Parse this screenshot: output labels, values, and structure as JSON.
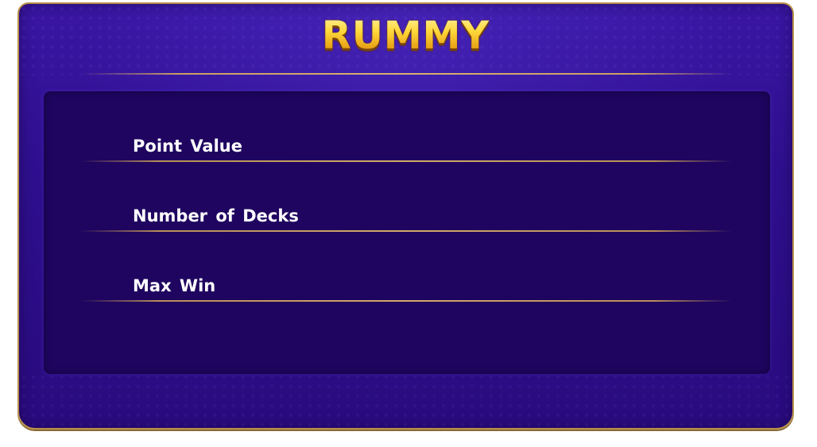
{
  "dialog": {
    "title": "RUMMY",
    "rows": [
      {
        "label": "Point Value"
      },
      {
        "label": "Number of Decks"
      },
      {
        "label": "Max Win"
      }
    ]
  },
  "colors": {
    "panel_background": "#2f0f8e",
    "inner_background": "#1f0560",
    "border_gold": "#b8904a",
    "title_gold": "#ffd23a",
    "label_text": "#ffffff"
  }
}
